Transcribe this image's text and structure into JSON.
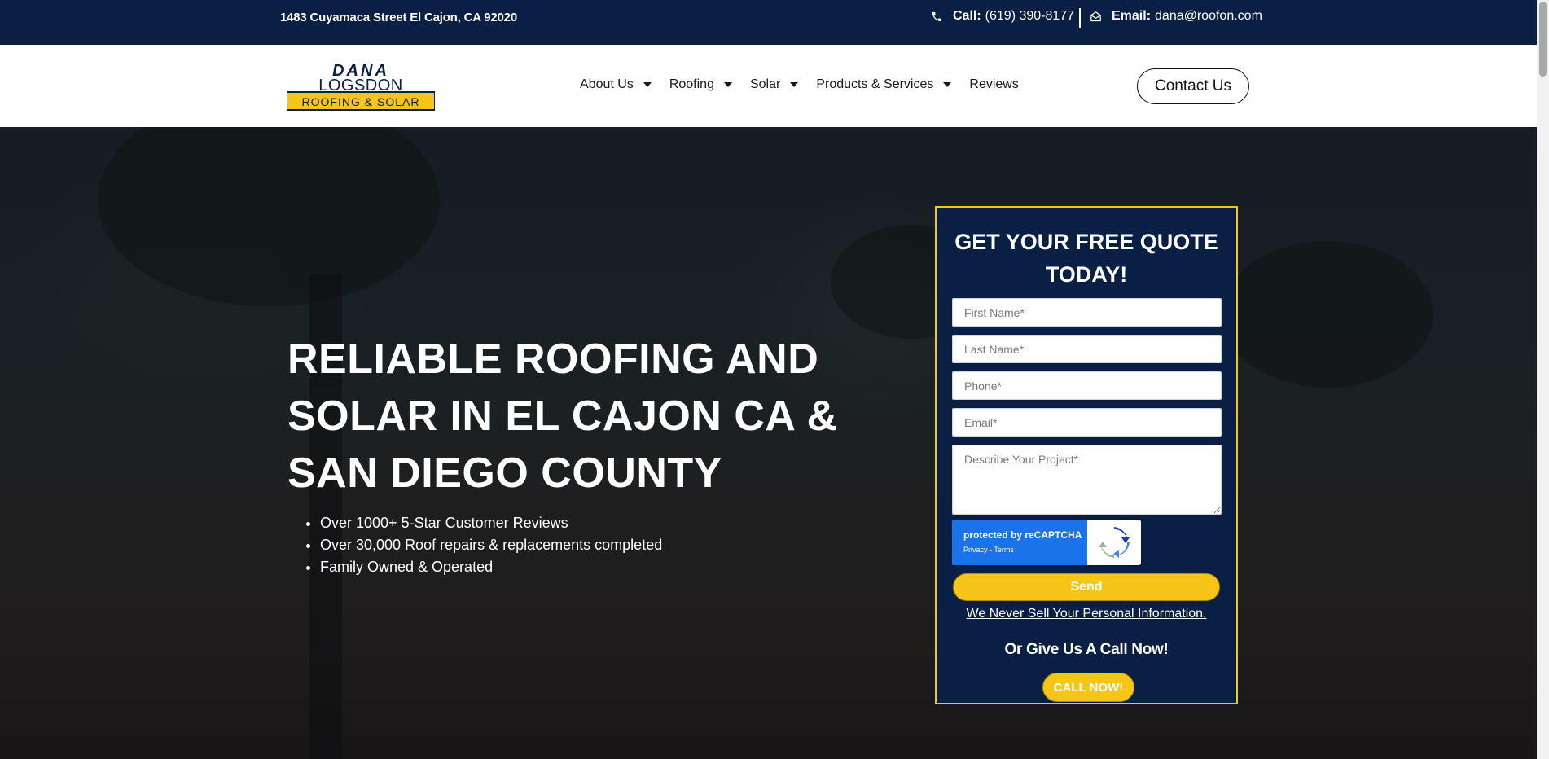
{
  "topbar": {
    "address": "1483 Cuyamaca Street El Cajon, CA 92020",
    "call_label": "Call:",
    "call_number": "(619) 390-8177",
    "email_label": "Email:",
    "email_address": "dana@roofon.com"
  },
  "logo": {
    "line1": "DANA",
    "line2": "LOGSDON",
    "line3": "ROOFING & SOLAR"
  },
  "nav": {
    "items": [
      {
        "label": "About Us",
        "has_dropdown": true
      },
      {
        "label": "Roofing",
        "has_dropdown": true
      },
      {
        "label": "Solar",
        "has_dropdown": true
      },
      {
        "label": "Products & Services",
        "has_dropdown": true
      },
      {
        "label": "Reviews",
        "has_dropdown": false
      }
    ],
    "contact_label": "Contact Us"
  },
  "hero": {
    "headline": "RELIABLE ROOFING AND SOLAR IN EL CAJON CA & SAN DIEGO COUNTY",
    "bullets": [
      "Over 1000+ 5-Star Customer Reviews",
      "Over 30,000 Roof repairs & replacements completed",
      "Family Owned & Operated"
    ]
  },
  "quote_form": {
    "title": "GET YOUR FREE QUOTE TODAY!",
    "first_name_placeholder": "First Name*",
    "last_name_placeholder": "Last Name*",
    "phone_placeholder": "Phone*",
    "email_placeholder": "Email*",
    "project_placeholder": "Describe Your Project*",
    "captcha_text": "protected by reCAPTCHA",
    "captcha_links": "Privacy - Terms",
    "send_label": "Send",
    "privacy_note": "We Never Sell Your Personal Information.",
    "call_prompt": "Or Give Us A Call Now!",
    "call_now_label": "CALL NOW!"
  },
  "colors": {
    "navy": "#0a1f44",
    "accent_yellow": "#f5c518"
  }
}
